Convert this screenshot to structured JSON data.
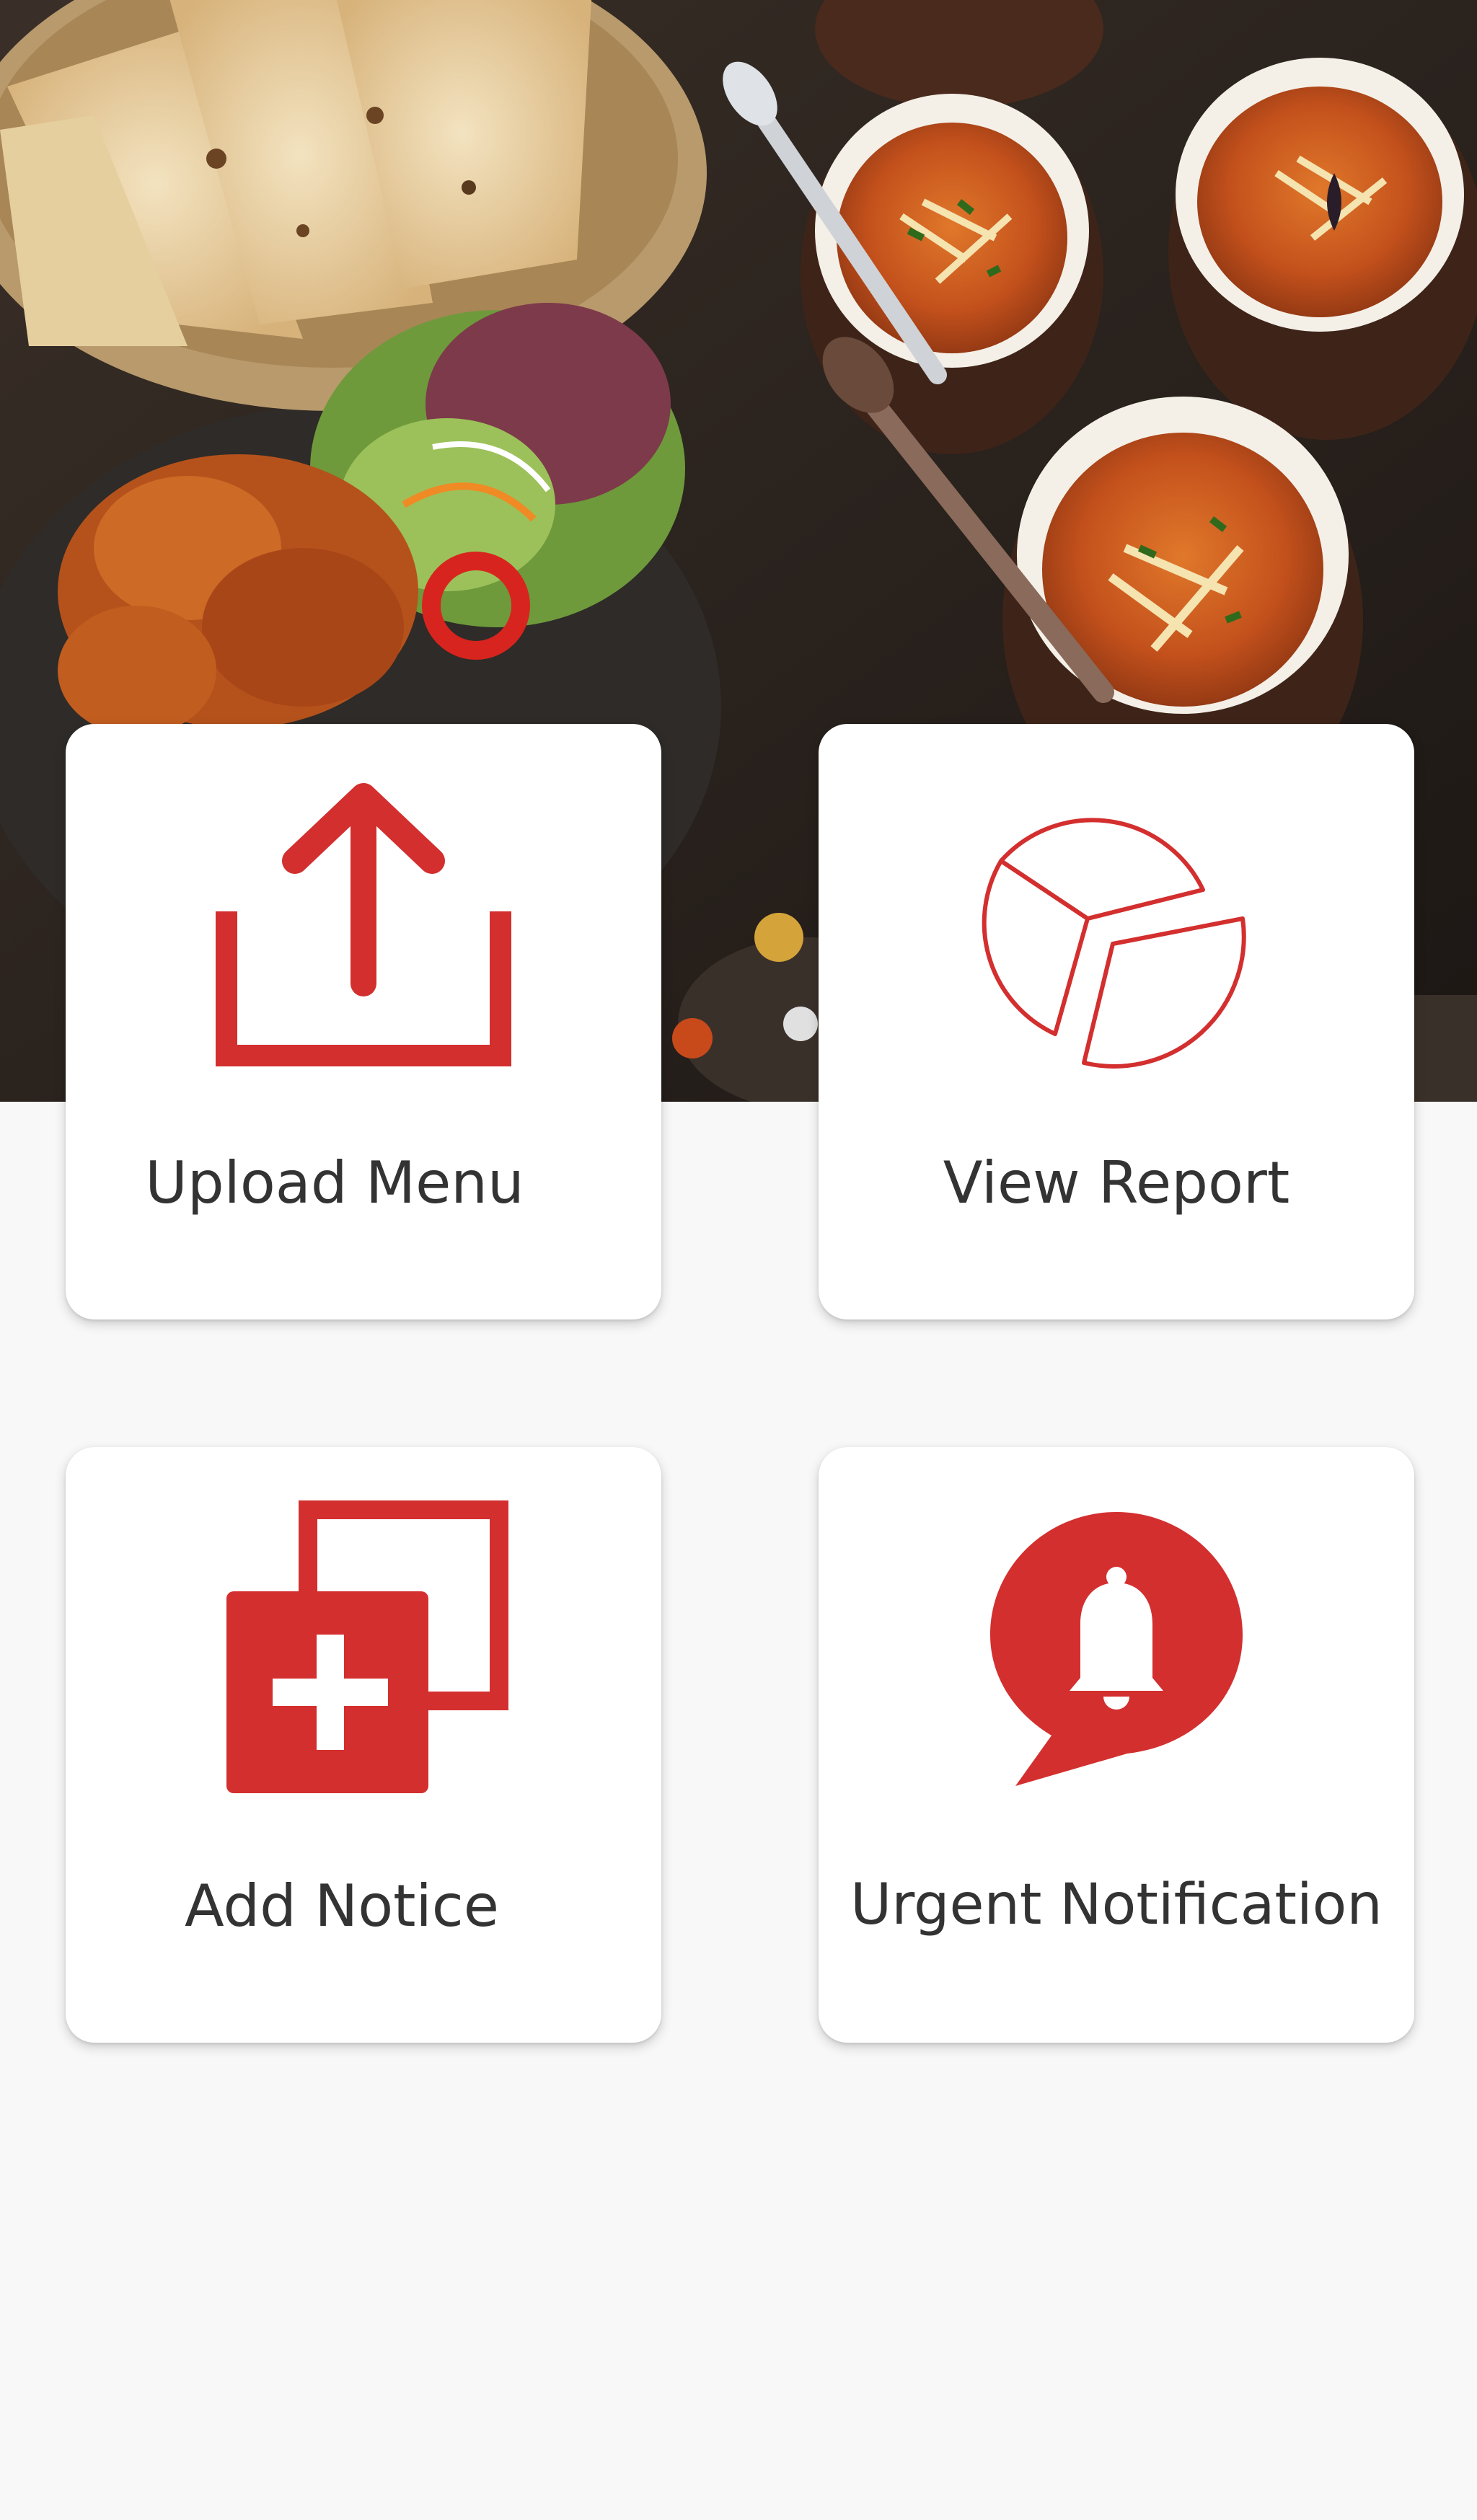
{
  "colors": {
    "accent": "#d32f2f",
    "background": "#f8f8f8",
    "card": "#ffffff",
    "label": "#333333"
  },
  "hero": {
    "image": "indian-food-spread-photo"
  },
  "menu": [
    {
      "id": "upload_menu",
      "label": "Upload Menu",
      "icon": "upload-icon"
    },
    {
      "id": "view_report",
      "label": "View Report",
      "icon": "pie-chart-icon"
    },
    {
      "id": "add_notice",
      "label": "Add Notice",
      "icon": "add-notice-icon"
    },
    {
      "id": "urgent_notification",
      "label": "Urgent Notification",
      "icon": "bell-bubble-icon"
    }
  ]
}
